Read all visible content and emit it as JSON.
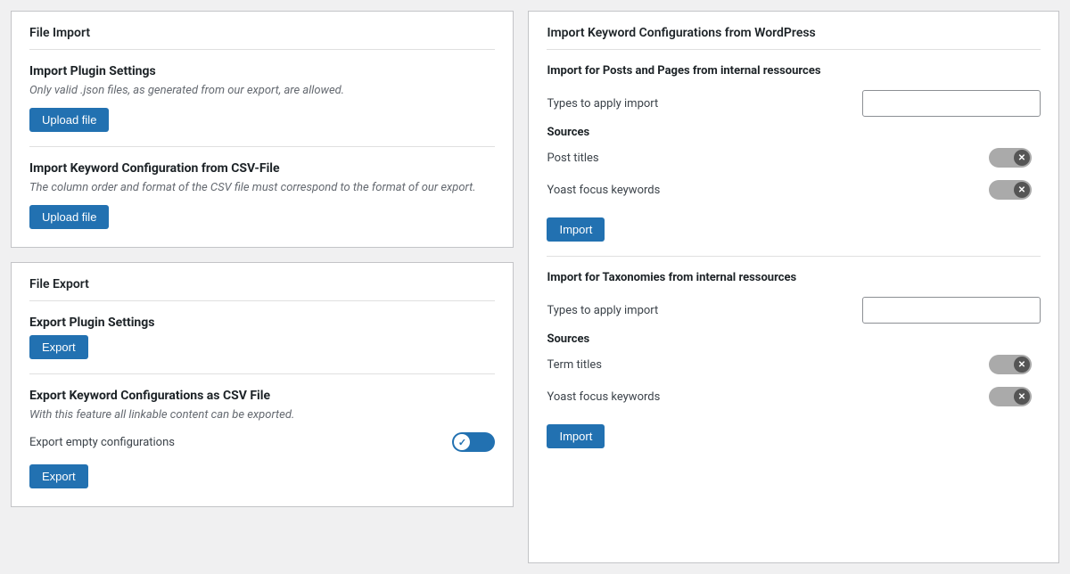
{
  "left": {
    "file_import": {
      "title": "File Import",
      "plugin_settings": {
        "heading": "Import Plugin Settings",
        "note": "Only valid .json files, as generated from our export, are allowed.",
        "button": "Upload file"
      },
      "csv_import": {
        "heading": "Import Keyword Configuration from CSV-File",
        "note": "The column order and format of the CSV file must correspond to the format of our export.",
        "button": "Upload file"
      }
    },
    "file_export": {
      "title": "File Export",
      "plugin_settings": {
        "heading": "Export Plugin Settings",
        "button": "Export"
      },
      "csv_export": {
        "heading": "Export Keyword Configurations as CSV File",
        "note": "With this feature all linkable content can be exported.",
        "toggle_label": "Export empty configurations",
        "button": "Export"
      }
    }
  },
  "right": {
    "title": "Import Keyword Configurations from WordPress",
    "posts_section": {
      "heading": "Import for Posts and Pages from internal ressources",
      "types_label": "Types to apply import",
      "sources_label": "Sources",
      "post_titles_label": "Post titles",
      "yoast_label": "Yoast focus keywords",
      "import_button": "Import"
    },
    "taxonomies_section": {
      "heading": "Import for Taxonomies from internal ressources",
      "types_label": "Types to apply import",
      "sources_label": "Sources",
      "term_titles_label": "Term titles",
      "yoast_label": "Yoast focus keywords",
      "import_button": "Import"
    }
  }
}
